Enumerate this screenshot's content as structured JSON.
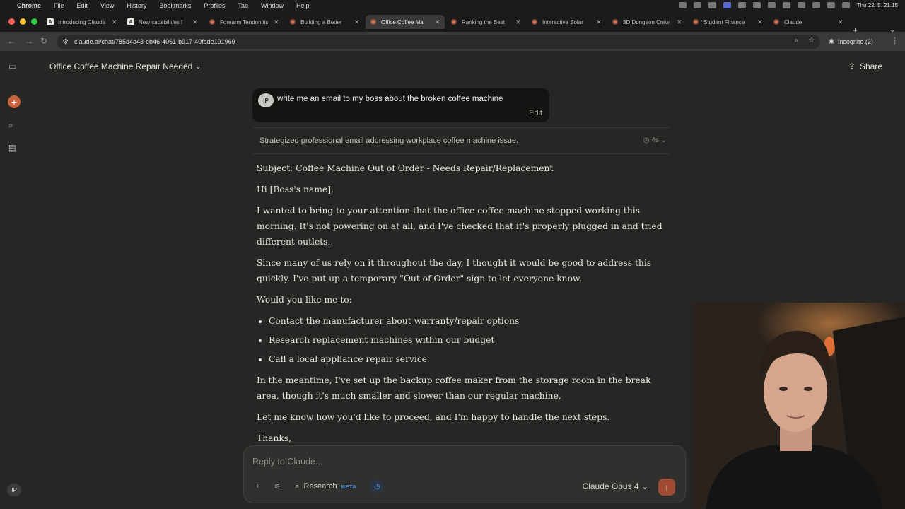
{
  "menubar": {
    "items": [
      "Chrome",
      "File",
      "Edit",
      "View",
      "History",
      "Bookmarks",
      "Profiles",
      "Tab",
      "Window",
      "Help"
    ],
    "clock": "Thu 22. 5.  21:15"
  },
  "tabs": [
    {
      "title": "Introducing Claude",
      "icon": "anthropic-a-icon"
    },
    {
      "title": "New capabilities f",
      "icon": "anthropic-a-icon"
    },
    {
      "title": "Forearm Tendonitis",
      "icon": "claude-icon"
    },
    {
      "title": "Building a Better",
      "icon": "claude-icon"
    },
    {
      "title": "Office Coffee Ma",
      "icon": "claude-icon",
      "active": true
    },
    {
      "title": "Ranking the Best",
      "icon": "claude-icon"
    },
    {
      "title": "Interactive Solar",
      "icon": "claude-icon"
    },
    {
      "title": "3D Dungeon Craw",
      "icon": "claude-icon"
    },
    {
      "title": "Student Finance",
      "icon": "claude-icon"
    },
    {
      "title": "Claude",
      "icon": "claude-icon"
    }
  ],
  "toolbar": {
    "url": "claude.ai/chat/785d4a43-eb46-4061-b917-40fade191969",
    "incognito": "Incognito (2)"
  },
  "chat": {
    "title": "Office Coffee Machine Repair Needed",
    "share": "Share",
    "user_initials": "IP",
    "user_message": "write me an email to my boss about the broken coffee machine",
    "edit": "Edit",
    "thought_summary": "Strategized professional email addressing workplace coffee machine issue.",
    "thought_time": "4s",
    "response": {
      "subject": "Subject: Coffee Machine Out of Order - Needs Repair/Replacement",
      "greeting": "Hi [Boss's name],",
      "p1": "I wanted to bring to your attention that the office coffee machine stopped working this morning. It's not powering on at all, and I've checked that it's properly plugged in and tried different outlets.",
      "p2": "Since many of us rely on it throughout the day, I thought it would be good to address this quickly. I've put up a temporary \"Out of Order\" sign to let everyone know.",
      "p3": "Would you like me to:",
      "bullets": [
        "Contact the manufacturer about warranty/repair options",
        "Research replacement machines within our budget",
        "Call a local appliance repair service"
      ],
      "p4": "In the meantime, I've set up the backup coffee maker from the storage room in the break area, though it's much smaller and slower than our regular machine.",
      "p5": "Let me know how you'd like to proceed, and I'm happy to handle the next steps.",
      "signoff": "Thanks,"
    }
  },
  "composer": {
    "placeholder": "Reply to Claude...",
    "research": "Research",
    "beta": "BETA",
    "model": "Claude Opus 4"
  },
  "sidebar": {
    "user_initials": "IP"
  },
  "colors": {
    "accent": "#c6613f",
    "background": "#262624",
    "beta": "#4a8fd9"
  }
}
